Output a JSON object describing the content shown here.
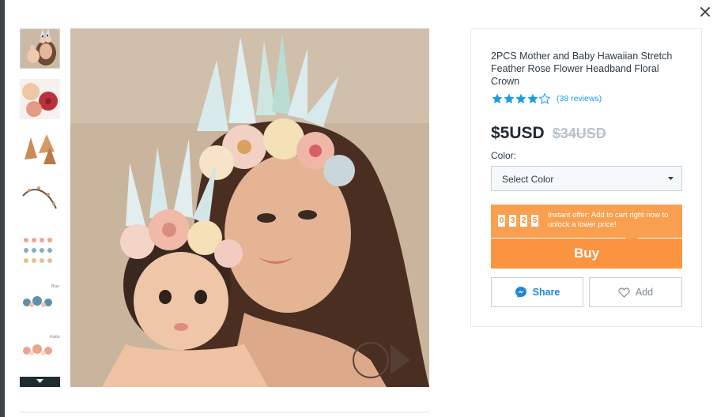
{
  "dialog": {
    "close_icon": "close-icon"
  },
  "gallery": {
    "thumbnails": [
      {
        "name": "mother-baby-crowns",
        "selected": true
      },
      {
        "name": "rose-flowers",
        "selected": false
      },
      {
        "name": "feathers",
        "selected": false
      },
      {
        "name": "vine-band",
        "selected": false
      },
      {
        "name": "color-variants-rows",
        "selected": false
      },
      {
        "name": "blue-variant",
        "label": "Blue",
        "selected": false
      },
      {
        "name": "pink-variant",
        "label": "Kiddos",
        "selected": false
      }
    ],
    "scroll_down_icon": "chevron-down-icon"
  },
  "product": {
    "title": "2PCS Mother and Baby Hawaiian Stretch Feather Rose Flower Headband Floral Crown",
    "rating": 4,
    "reviews": "(38 reviews)",
    "price": "$5USD",
    "old_price": "$34USD",
    "color_label": "Color:",
    "color_select": "Select Color",
    "countdown_digits": [
      "0",
      "3",
      "2",
      "5"
    ],
    "countdown_separator": ":",
    "offer_text": "Instant offer: Add to cart right now to unlock a lower price!",
    "buy_label": "Buy",
    "share_label": "Share",
    "add_label": "Add"
  },
  "colors": {
    "accent_orange": "#fa9441",
    "offer_orange": "#f8a04f",
    "star_blue": "#1a9be6",
    "share_blue": "#1f88d6"
  }
}
